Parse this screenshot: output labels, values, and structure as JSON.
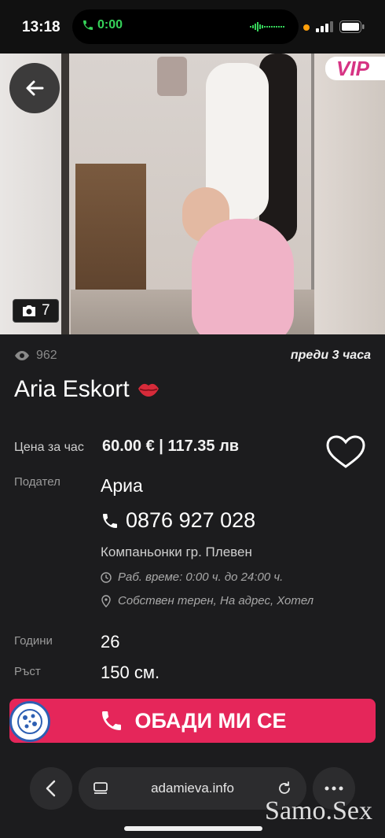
{
  "status_bar": {
    "time": "13:18",
    "call_timer": "0:00"
  },
  "gallery": {
    "badge": "VIP",
    "photo_count": "7"
  },
  "listing": {
    "views": "962",
    "posted": "преди 3 часа",
    "title": "Aria Eskort",
    "price_label": "Цена за час",
    "price": "60.00 € | 117.35 лв",
    "poster_label": "Подател",
    "poster_name": "Ариа",
    "phone": "0876 927 028",
    "category": "Компаньонки гр. Плевен",
    "hours": "Раб. време: 0:00 ч. до 24:00 ч.",
    "place": "Собствен терен, На адрес, Хотел",
    "age_label": "Години",
    "age": "26",
    "height_label": "Ръст",
    "height": "150 см."
  },
  "actions": {
    "call_label": "ОБАДИ МИ СЕ"
  },
  "browser": {
    "url": "adamieva.info"
  },
  "watermark": "Samo.Sex",
  "colors": {
    "accent": "#e5265a",
    "call_green": "#36d35a",
    "background": "#1c1c1e"
  }
}
